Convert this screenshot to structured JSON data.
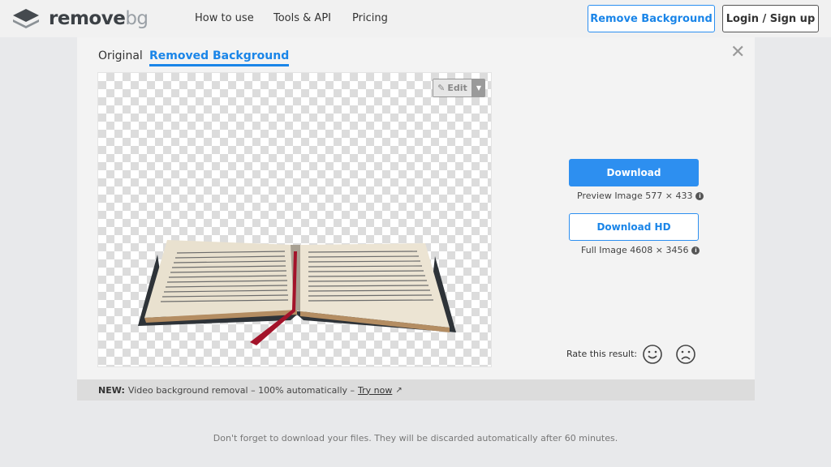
{
  "header": {
    "logo_main": "remove",
    "logo_bg": "bg",
    "nav": [
      "How to use",
      "Tools & API",
      "Pricing"
    ],
    "remove_background_label": "Remove Background",
    "login_label": "Login / Sign up"
  },
  "card": {
    "tabs": [
      "Original",
      "Removed Background"
    ],
    "active_tab": "Removed Background",
    "close_glyph": "✕",
    "edit_label": "Edit",
    "download_label": "Download",
    "preview_caption": "Preview Image 577 × 433",
    "download_hd_label": "Download HD",
    "full_caption": "Full Image 4608 × 3456",
    "rate_label": "Rate this result:"
  },
  "banner": {
    "new_label": "NEW:",
    "text": "Video background removal – 100% automatically –",
    "link": "Try now"
  },
  "footnote": "Don't forget to download your files. They will be discarded automatically after 60 minutes.",
  "colors": {
    "accent": "#2d8ff0",
    "background": "#e8e9eb"
  }
}
